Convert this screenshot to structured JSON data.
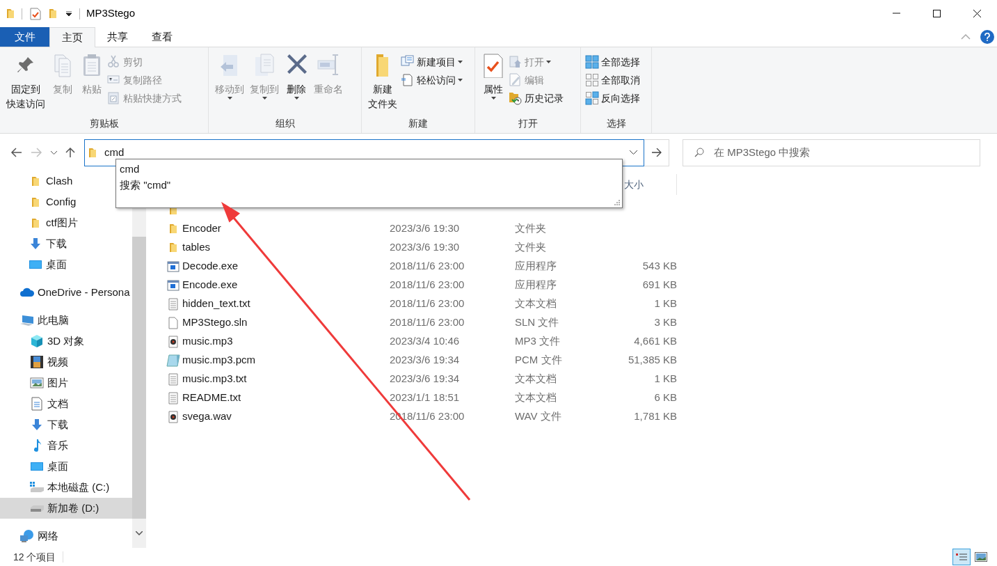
{
  "window": {
    "title": "MP3Stego"
  },
  "ribbon": {
    "tabs": [
      {
        "label": "文件",
        "kind": "file",
        "selected": false
      },
      {
        "label": "主页",
        "kind": "tab",
        "selected": true
      },
      {
        "label": "共享",
        "kind": "tab",
        "selected": false
      },
      {
        "label": "查看",
        "kind": "tab",
        "selected": false
      }
    ],
    "groups": [
      {
        "label": "剪贴板",
        "buttons": [
          {
            "kind": "pin",
            "label_lines": [
              "固定到",
              "快速访问"
            ],
            "disabled": false,
            "dropdown": false
          },
          {
            "kind": "copy",
            "label": "复制",
            "disabled": true,
            "dropdown": false
          },
          {
            "kind": "paste",
            "label": "粘贴",
            "disabled": true,
            "dropdown": false
          },
          {
            "kind": "cut",
            "label": "剪切",
            "disabled": true,
            "dropdown": false
          },
          {
            "kind": "copy-path",
            "label": "复制路径",
            "disabled": true,
            "dropdown": false
          },
          {
            "kind": "paste-shortcut",
            "label": "粘贴快捷方式",
            "disabled": true,
            "dropdown": false
          }
        ]
      },
      {
        "label": "组织",
        "buttons": [
          {
            "kind": "move",
            "label": "移动到",
            "disabled": true,
            "dropdown": true
          },
          {
            "kind": "copy-to",
            "label": "复制到",
            "disabled": true,
            "dropdown": true
          },
          {
            "kind": "delete",
            "label": "删除",
            "disabled": false,
            "dropdown": true
          },
          {
            "kind": "rename",
            "label": "重命名",
            "disabled": true,
            "dropdown": false
          }
        ]
      },
      {
        "label": "新建",
        "buttons": [
          {
            "kind": "new-folder",
            "label_lines": [
              "新建",
              "文件夹"
            ],
            "disabled": false,
            "dropdown": false
          },
          {
            "kind": "new-item",
            "label": "新建项目",
            "disabled": false,
            "dropdown": true
          },
          {
            "kind": "easy-access",
            "label": "轻松访问",
            "disabled": false,
            "dropdown": true
          }
        ]
      },
      {
        "label": "打开",
        "buttons": [
          {
            "kind": "properties",
            "label": "属性",
            "disabled": false,
            "dropdown": true
          },
          {
            "kind": "open",
            "label": "打开",
            "disabled": true,
            "dropdown": true
          },
          {
            "kind": "edit",
            "label": "编辑",
            "disabled": true,
            "dropdown": false
          },
          {
            "kind": "history",
            "label": "历史记录",
            "disabled": false,
            "dropdown": false
          }
        ]
      },
      {
        "label": "选择",
        "buttons": [
          {
            "kind": "select-all",
            "label": "全部选择",
            "disabled": false,
            "dropdown": false
          },
          {
            "kind": "select-none",
            "label": "全部取消",
            "disabled": false,
            "dropdown": false
          },
          {
            "kind": "invert",
            "label": "反向选择",
            "disabled": false,
            "dropdown": false
          }
        ]
      }
    ]
  },
  "navigation_bar": {
    "back_disabled": false,
    "forward_disabled": true,
    "address": "cmd",
    "search": {
      "placeholder": "在 MP3Stego 中搜索"
    }
  },
  "address_suggestions": [
    "cmd",
    "搜索 \"cmd\""
  ],
  "sidebar": {
    "items": [
      {
        "children": [
          {
            "label": "Clash",
            "kind": "folder",
            "selected": false
          },
          {
            "label": "Config",
            "kind": "folder",
            "selected": false
          },
          {
            "label": "ctf图片",
            "kind": "folder",
            "selected": false
          },
          {
            "label": "下载",
            "kind": "download",
            "selected": false
          },
          {
            "label": "桌面",
            "kind": "desktop",
            "selected": false
          }
        ]
      },
      {
        "label": "OneDrive - Persona",
        "kind": "cloud",
        "selected": false
      },
      {
        "label": "此电脑",
        "kind": "pc",
        "selected": false,
        "children": [
          {
            "label": "3D 对象",
            "kind": "cube",
            "selected": false
          },
          {
            "label": "视频",
            "kind": "video",
            "selected": false
          },
          {
            "label": "图片",
            "kind": "picture",
            "selected": false
          },
          {
            "label": "文档",
            "kind": "document",
            "selected": false
          },
          {
            "label": "下载",
            "kind": "download",
            "selected": false
          },
          {
            "label": "音乐",
            "kind": "music",
            "selected": false
          },
          {
            "label": "桌面",
            "kind": "desktop",
            "selected": false
          },
          {
            "label": "本地磁盘 (C:)",
            "kind": "system-drive",
            "selected": false
          },
          {
            "label": "新加卷 (D:)",
            "kind": "drive",
            "selected": true
          }
        ]
      },
      {
        "label": "网络",
        "kind": "network",
        "selected": false
      }
    ]
  },
  "table": {
    "columns": [
      "大小"
    ],
    "rows": [
      {
        "kind": "folder"
      },
      {
        "kind": "folder",
        "name": "Encoder",
        "modified": "2023/3/6 19:30",
        "type": "文件夹"
      },
      {
        "kind": "folder",
        "name": "tables",
        "modified": "2023/3/6 19:30",
        "type": "文件夹"
      },
      {
        "kind": "exe",
        "name": "Decode.exe",
        "modified": "2018/11/6 23:00",
        "type": "应用程序",
        "size": "543 KB"
      },
      {
        "kind": "exe",
        "name": "Encode.exe",
        "modified": "2018/11/6 23:00",
        "type": "应用程序",
        "size": "691 KB"
      },
      {
        "kind": "text",
        "name": "hidden_text.txt",
        "modified": "2018/11/6 23:00",
        "type": "文本文档",
        "size": "1 KB"
      },
      {
        "kind": "blank",
        "name": "MP3Stego.sln",
        "modified": "2018/11/6 23:00",
        "type": "SLN 文件",
        "size": "3 KB"
      },
      {
        "kind": "audio",
        "name": "music.mp3",
        "modified": "2023/3/4 10:46",
        "type": "MP3 文件",
        "size": "4,661 KB"
      },
      {
        "kind": "pcm",
        "name": "music.mp3.pcm",
        "modified": "2023/3/6 19:34",
        "type": "PCM 文件",
        "size": "51,385 KB"
      },
      {
        "kind": "text",
        "name": "music.mp3.txt",
        "modified": "2023/3/6 19:34",
        "type": "文本文档",
        "size": "1 KB"
      },
      {
        "kind": "text",
        "name": "README.txt",
        "modified": "2023/1/1 18:51",
        "type": "文本文档",
        "size": "6 KB"
      },
      {
        "kind": "audio",
        "name": "svega.wav",
        "modified": "2018/11/6 23:00",
        "type": "WAV 文件",
        "size": "1,781 KB"
      }
    ]
  },
  "status_bar": {
    "item_count": "12 个项目",
    "views": [
      {
        "kind": "details",
        "selected": true
      },
      {
        "kind": "large-icons",
        "selected": false
      }
    ]
  }
}
